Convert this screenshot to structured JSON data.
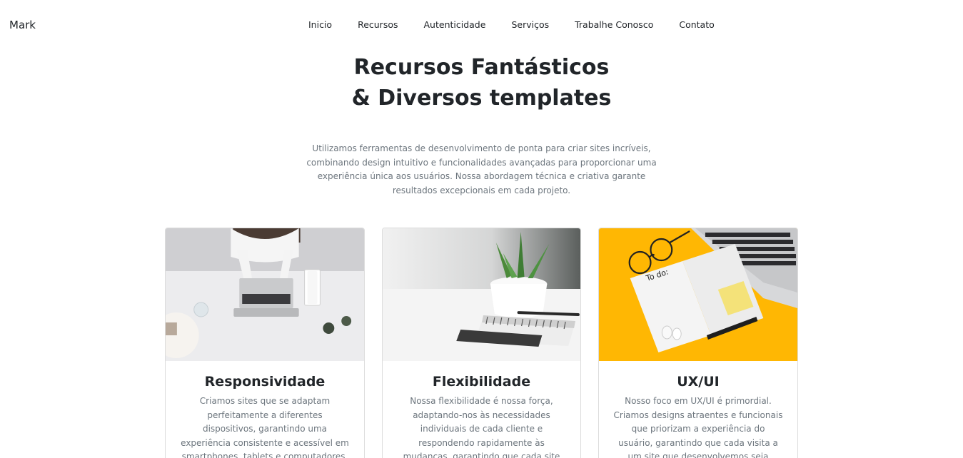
{
  "navbar": {
    "brand": "Mark",
    "links": [
      "Inicio",
      "Recursos",
      "Autenticidade",
      "Serviços",
      "Trabalhe Conosco",
      "Contato"
    ]
  },
  "hero": {
    "title_line1": "Recursos Fantásticos",
    "title_line2": "& Diversos templates",
    "description": "Utilizamos ferramentas de desenvolvimento de ponta para criar sites incríveis, combinando design intuitivo e funcionalidades avançadas para proporcionar uma experiência única aos usuários. Nossa abordagem técnica e criativa garante resultados excepcionais em cada projeto."
  },
  "cards": [
    {
      "title": "Responsividade",
      "text": "Criamos sites que se adaptam perfeitamente a diferentes dispositivos, garantindo uma experiência consistente e acessível em smartphones, tablets e computadores, alcançando um público"
    },
    {
      "title": "Flexibilidade",
      "text": "Nossa flexibilidade é nossa força, adaptando-nos às necessidades individuais de cada cliente e respondendo rapidamente às mudanças, garantindo que cada site seja único e eficaz."
    },
    {
      "title": "UX/UI",
      "text": "Nosso foco em UX/UI é primordial. Criamos designs atraentes e funcionais que priorizam a experiência do usuário, garantindo que cada visita a um site que desenvolvemos seja intuitiva, agradável e"
    }
  ],
  "card_images": [
    "laptop-desk-photo",
    "plant-notebook-photo",
    "todo-notebook-photo"
  ],
  "colors": {
    "text": "#212529",
    "muted": "#6c757d",
    "card_border": "#dcdcdc",
    "yellow": "#ffb703"
  }
}
